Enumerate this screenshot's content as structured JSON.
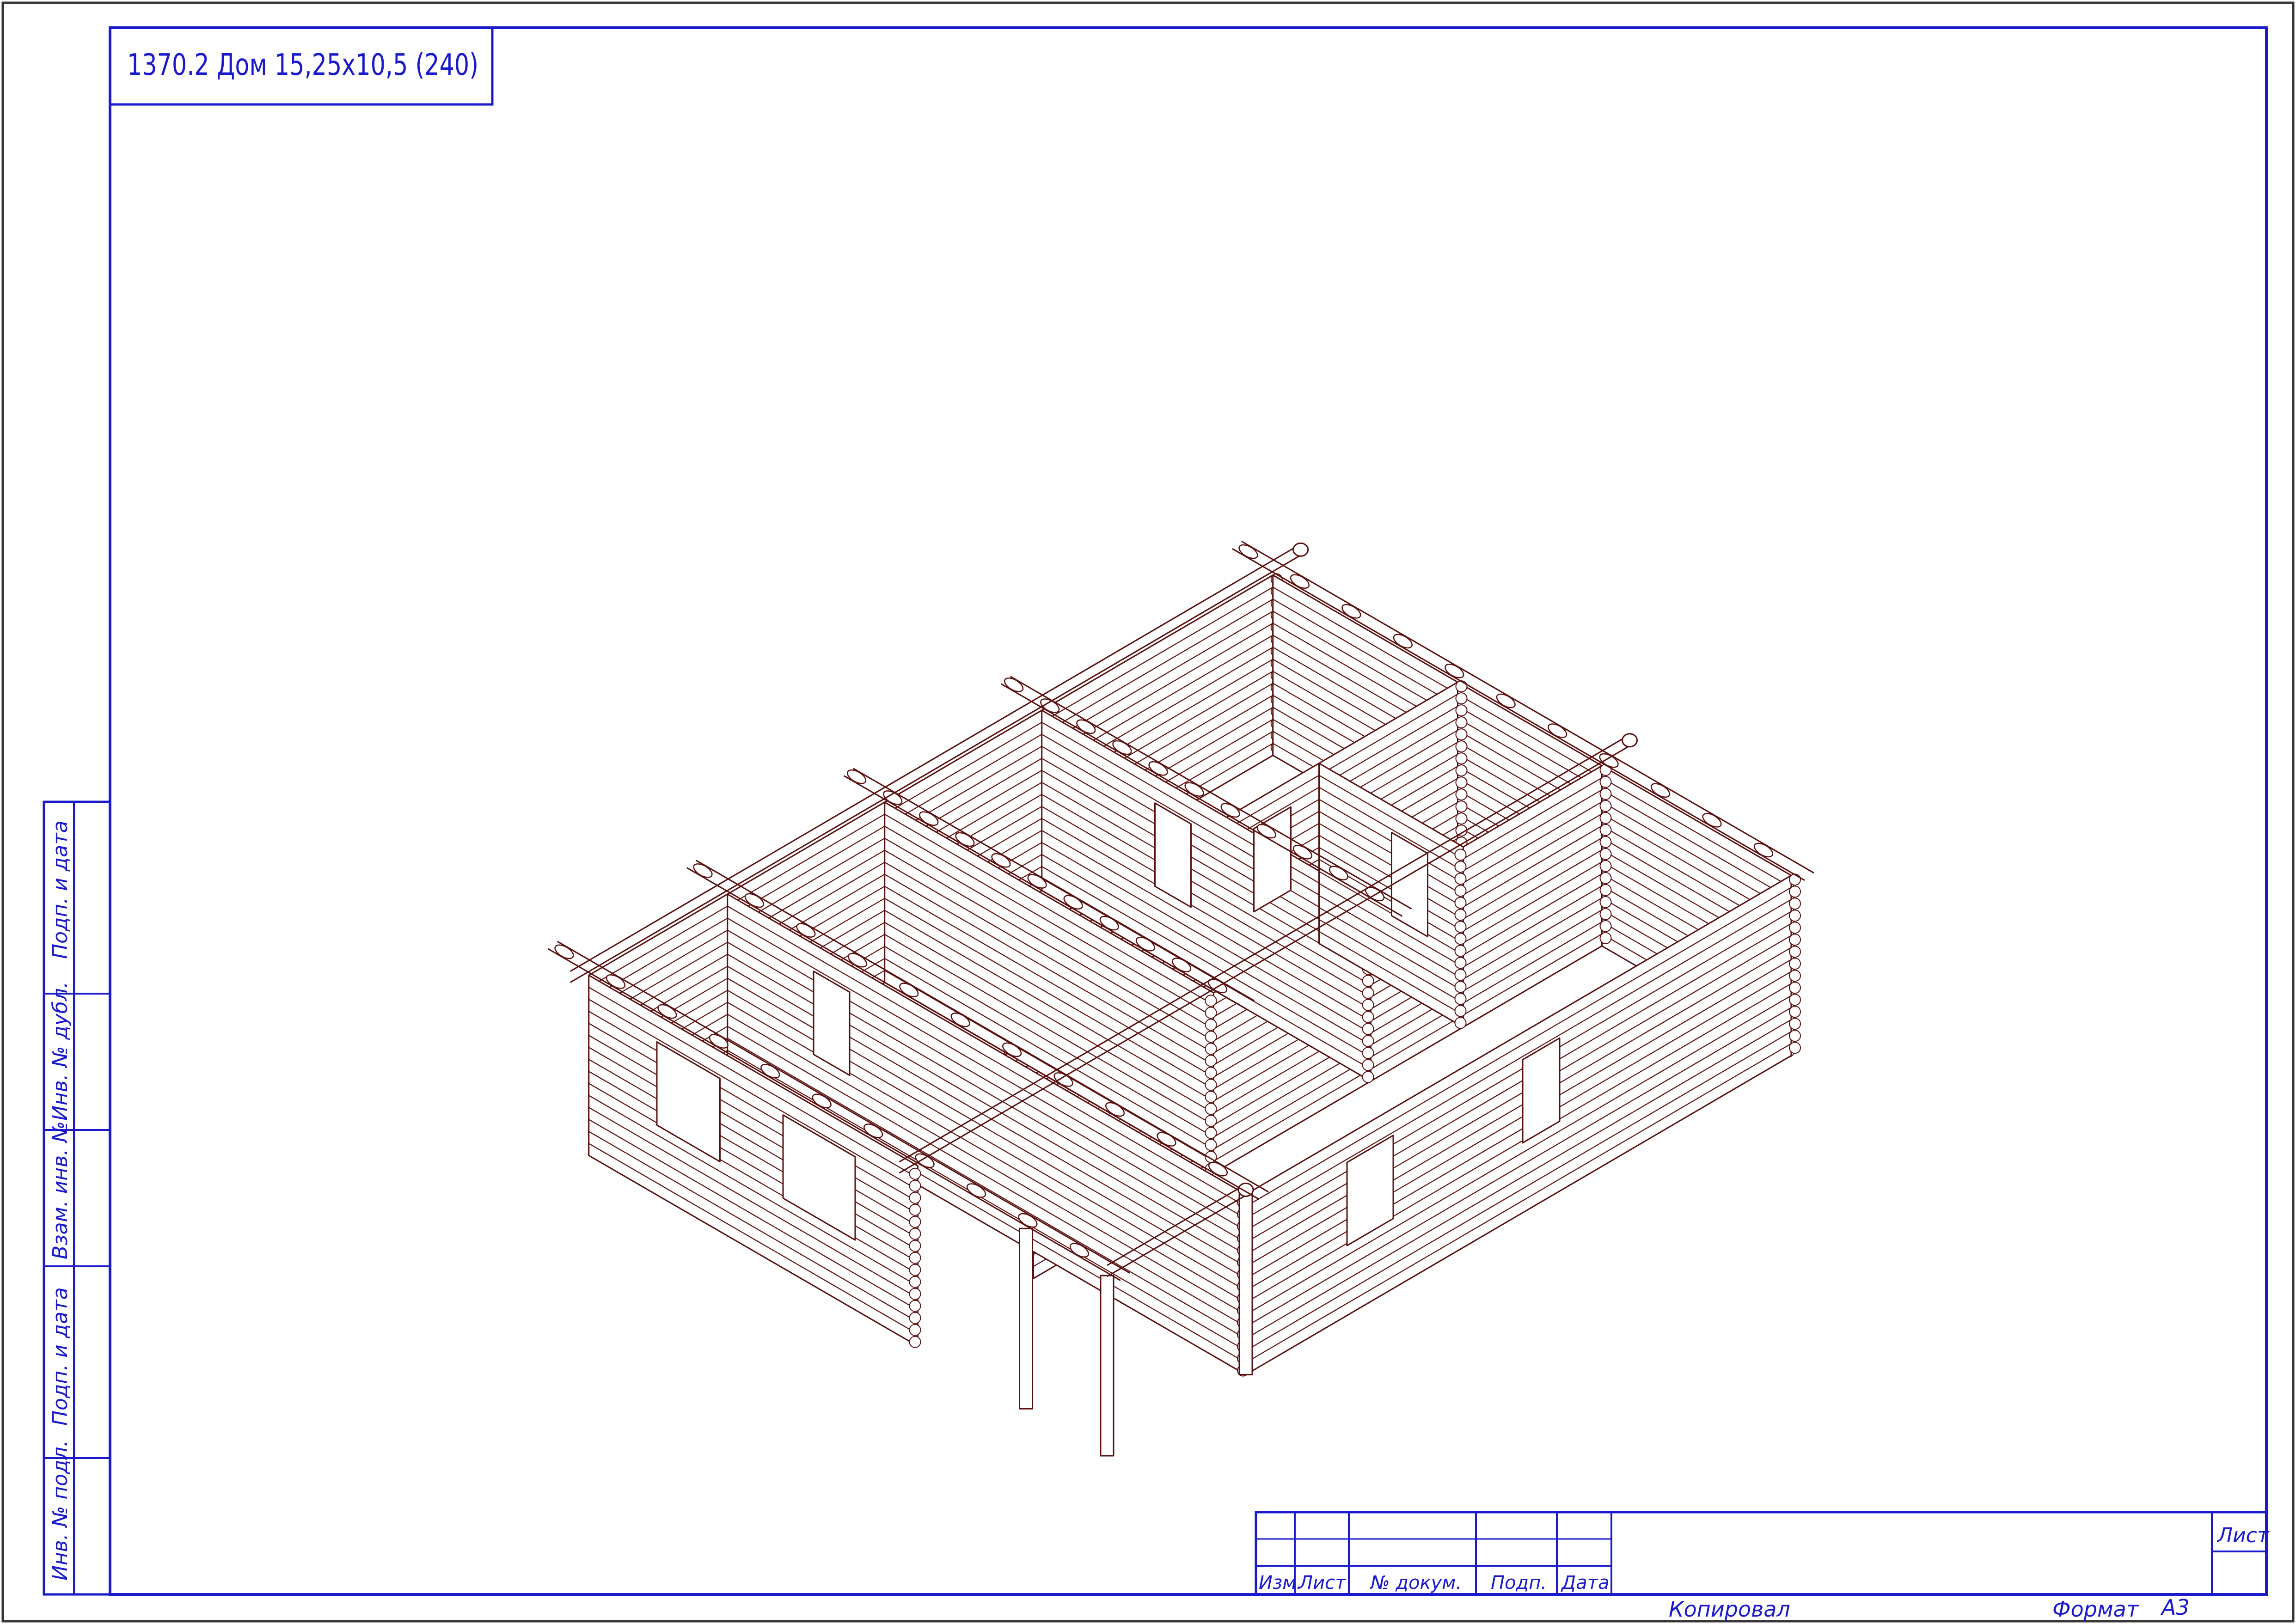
{
  "drawing": {
    "title": "1370.2 Дом 15,25х10,5 (240)"
  },
  "side_stamp": {
    "labels": [
      "Инв. № подл.",
      "Подп. и дата",
      "Взам. инв. №",
      "Инв. № дубл.",
      "Подп. и дата"
    ]
  },
  "title_block": {
    "headers": [
      "Изм.",
      "Лист",
      "№ докум.",
      "Подп.",
      "Дата"
    ],
    "sheet_label": "Лист",
    "copied_label": "Копировал",
    "format_label": "Формат",
    "format_value": "А3"
  },
  "colors": {
    "frame": "#1a1acc",
    "outer": "#333333",
    "log_stroke": "#5a1010",
    "text": "#1a1acc"
  }
}
